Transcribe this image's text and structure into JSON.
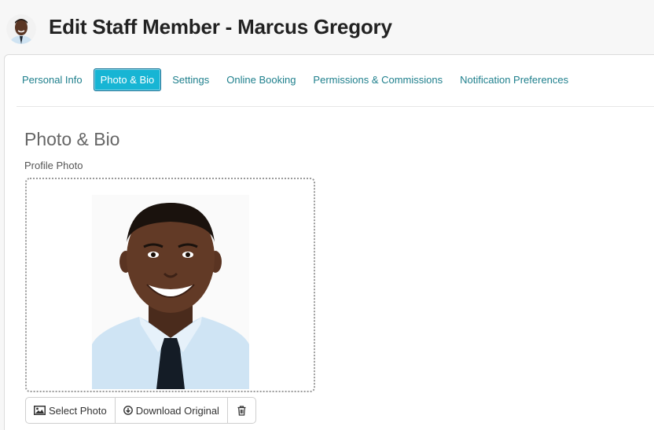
{
  "header": {
    "title": "Edit Staff Member - Marcus Gregory"
  },
  "tabs": [
    {
      "label": "Personal Info",
      "active": false
    },
    {
      "label": "Photo & Bio",
      "active": true
    },
    {
      "label": "Settings",
      "active": false
    },
    {
      "label": "Online Booking",
      "active": false
    },
    {
      "label": "Permissions & Commissions",
      "active": false
    },
    {
      "label": "Notification Preferences",
      "active": false
    }
  ],
  "section": {
    "title": "Photo & Bio",
    "profile_photo_label": "Profile Photo"
  },
  "photo_actions": {
    "select_label": "Select Photo",
    "download_label": "Download Original",
    "select_icon": "image-icon",
    "download_icon": "download-circle-icon",
    "delete_icon": "trash-icon"
  },
  "colors": {
    "tab_text": "#1e7f8c",
    "tab_active_bg": "#17b5d4",
    "tab_active_border": "#0c6e93"
  }
}
